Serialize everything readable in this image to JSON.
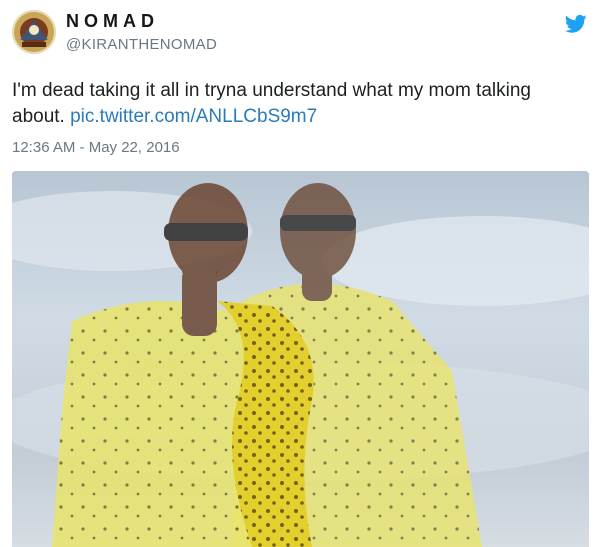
{
  "user": {
    "display_name": "NOMAD",
    "handle": "@KIRANTHENOMAD",
    "avatar_icon": "avatar-icon"
  },
  "brand": {
    "icon": "twitter-bird-icon",
    "color": "#1da1f2"
  },
  "tweet": {
    "text": "I'm dead taking it all in tryna understand what my mom talking about.",
    "link": "pic.twitter.com/ANLLCbS9m7",
    "link_color": "#2b7bb9",
    "timestamp": "12:36 AM - May 22, 2016"
  },
  "media": {
    "type": "photo"
  }
}
